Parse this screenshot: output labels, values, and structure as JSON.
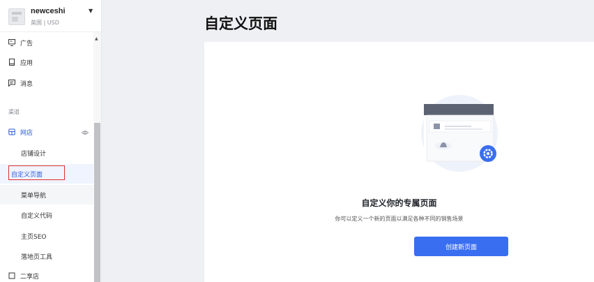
{
  "store": {
    "name": "newceshi",
    "sub": "英国 | USD"
  },
  "nav": {
    "ads": "广告",
    "apps": "应用",
    "messages": "消息",
    "channel_section": "渠道",
    "online_store": "网店",
    "sub_items": [
      "店铺设计",
      "自定义页面",
      "菜单导航",
      "自定义代码",
      "主页SEO",
      "落地页工具"
    ],
    "bottom_partial": "二享店"
  },
  "main": {
    "page_title": "自定义页面",
    "empty_title": "自定义你的专属页面",
    "empty_desc": "你可以定义一个新的页面以满足各种不同的销售场景",
    "create_button": "创建新页面"
  },
  "colors": {
    "primary": "#3a6ef0",
    "active_text": "#2d5bd7",
    "highlight_box": "#e02e2e"
  }
}
